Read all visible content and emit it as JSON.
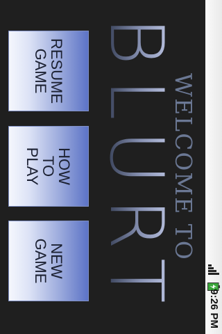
{
  "app": {
    "welcome_text": "WELCOME TO",
    "logo_text": "BLURT"
  },
  "menu": {
    "new_game": [
      "NEW",
      "GAME"
    ],
    "how_to_play": [
      "HOW",
      "TO",
      "PLAY"
    ],
    "resume_game": [
      "RESUME",
      "GAME"
    ]
  },
  "status_bar": {
    "time": "9:26 PM",
    "icons": [
      "signal-icon",
      "battery-charging-icon"
    ]
  },
  "colors": {
    "background": "#1f1f1f",
    "welcome_text": "#6b7894",
    "button_top": "#5c73c6",
    "button_bottom": "#f5f7fd",
    "button_text": "#1c2132"
  }
}
